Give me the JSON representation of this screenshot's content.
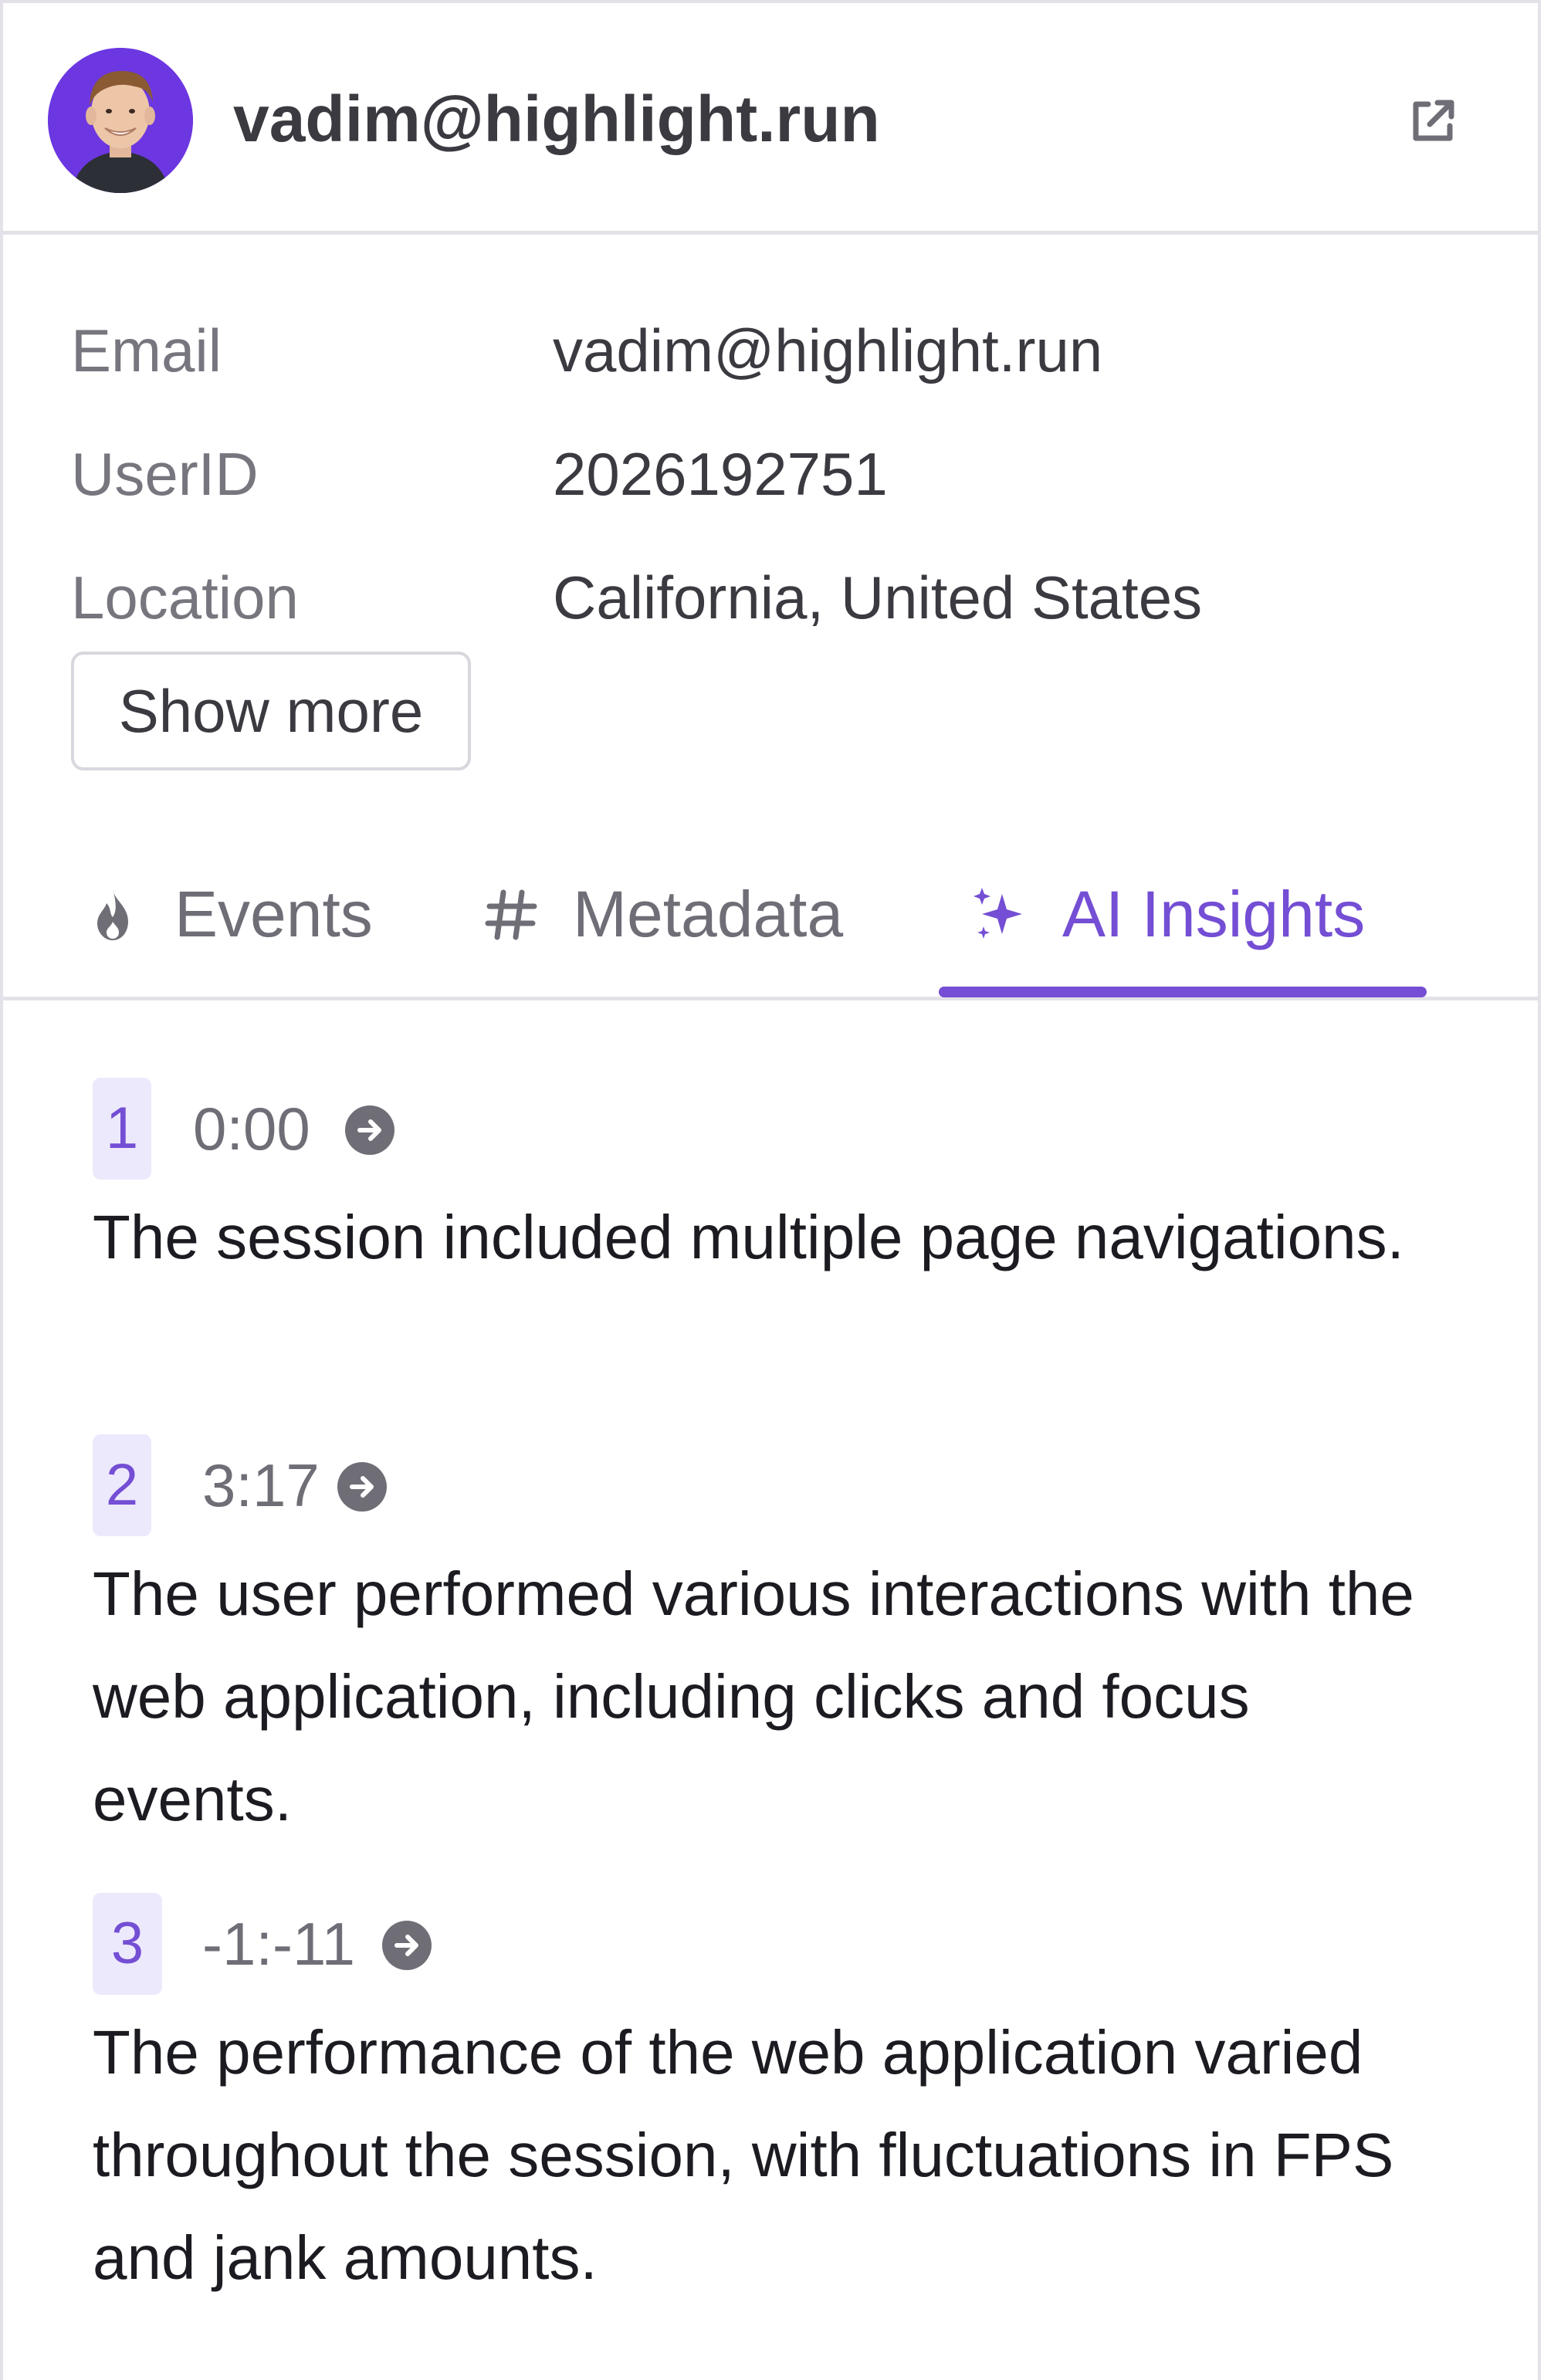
{
  "user": {
    "name": "vadim@highlight.run",
    "avatar_icon": "user-avatar-photo",
    "open_icon": "external-link-icon"
  },
  "details": [
    {
      "key": "Email",
      "value": "vadim@highlight.run"
    },
    {
      "key": "UserID",
      "value": "2026192751"
    },
    {
      "key": "Location",
      "value": "California, United States"
    }
  ],
  "show_more_label": "Show more",
  "tabs": [
    {
      "label": "Events",
      "icon": "flame-icon",
      "active": false
    },
    {
      "label": "Metadata",
      "icon": "hash-icon",
      "active": false
    },
    {
      "label": "AI Insights",
      "icon": "sparkles-icon",
      "active": true
    }
  ],
  "insights": [
    {
      "number": "1",
      "timestamp": "0:00",
      "text": "The session included multiple page navigations."
    },
    {
      "number": "2",
      "timestamp": "3:17",
      "text": "The user performed various interactions with the web application, including clicks and focus events."
    },
    {
      "number": "3",
      "timestamp": "-1:-11",
      "text": "The performance of the web application varied throughout the session, with fluctuations in FPS and jank amounts."
    }
  ],
  "colors": {
    "accent": "#744ed4",
    "badge_bg": "#ede9fd",
    "avatar_bg": "#6c37e0",
    "border": "#e4e2e8",
    "text_primary": "#1c1b21",
    "text_secondary": "#6f6e77"
  }
}
